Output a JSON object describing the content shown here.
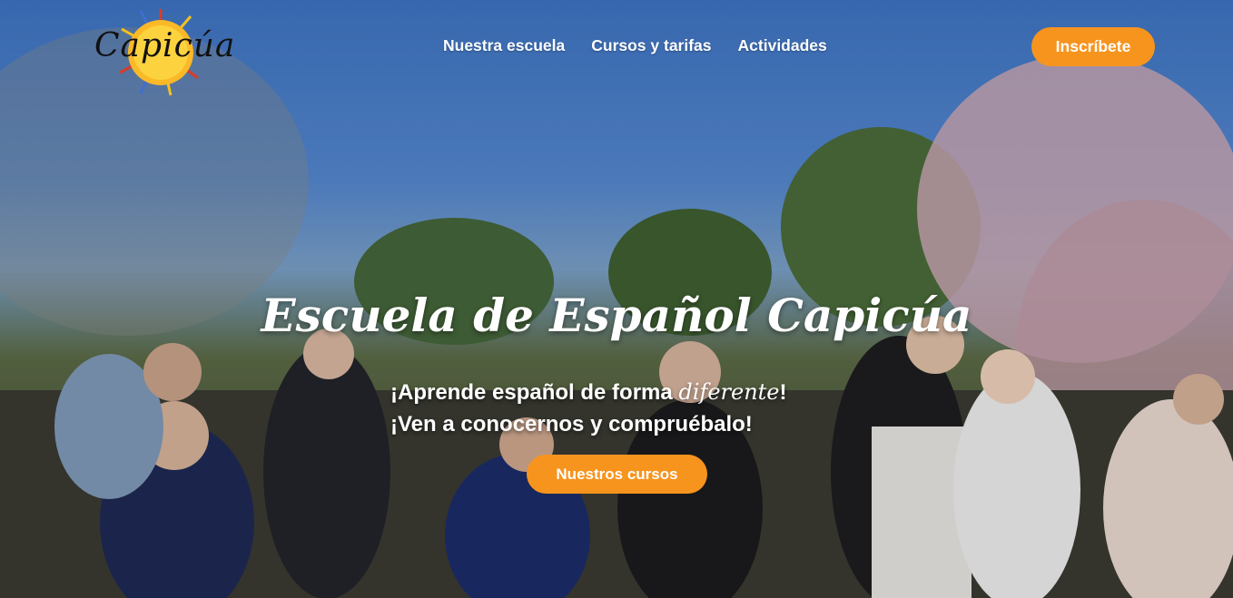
{
  "brand": {
    "name": "Capicúa"
  },
  "nav": {
    "items": [
      {
        "label": "Nuestra escuela"
      },
      {
        "label": "Cursos y tarifas"
      },
      {
        "label": "Actividades"
      }
    ],
    "cta_label": "Inscríbete"
  },
  "hero": {
    "title": "Escuela de Español Capicúa",
    "line1_prefix": "¡Aprende español de forma ",
    "line1_emphasis": "diferente",
    "line1_suffix": "!",
    "line2": "¡Ven a conocernos y compruébalo!",
    "cta_label": "Nuestros cursos"
  },
  "colors": {
    "accent": "#f7941d",
    "sky": "#3e74c3",
    "text": "#ffffff"
  },
  "icons": {
    "logo": "sun-logo-icon"
  }
}
